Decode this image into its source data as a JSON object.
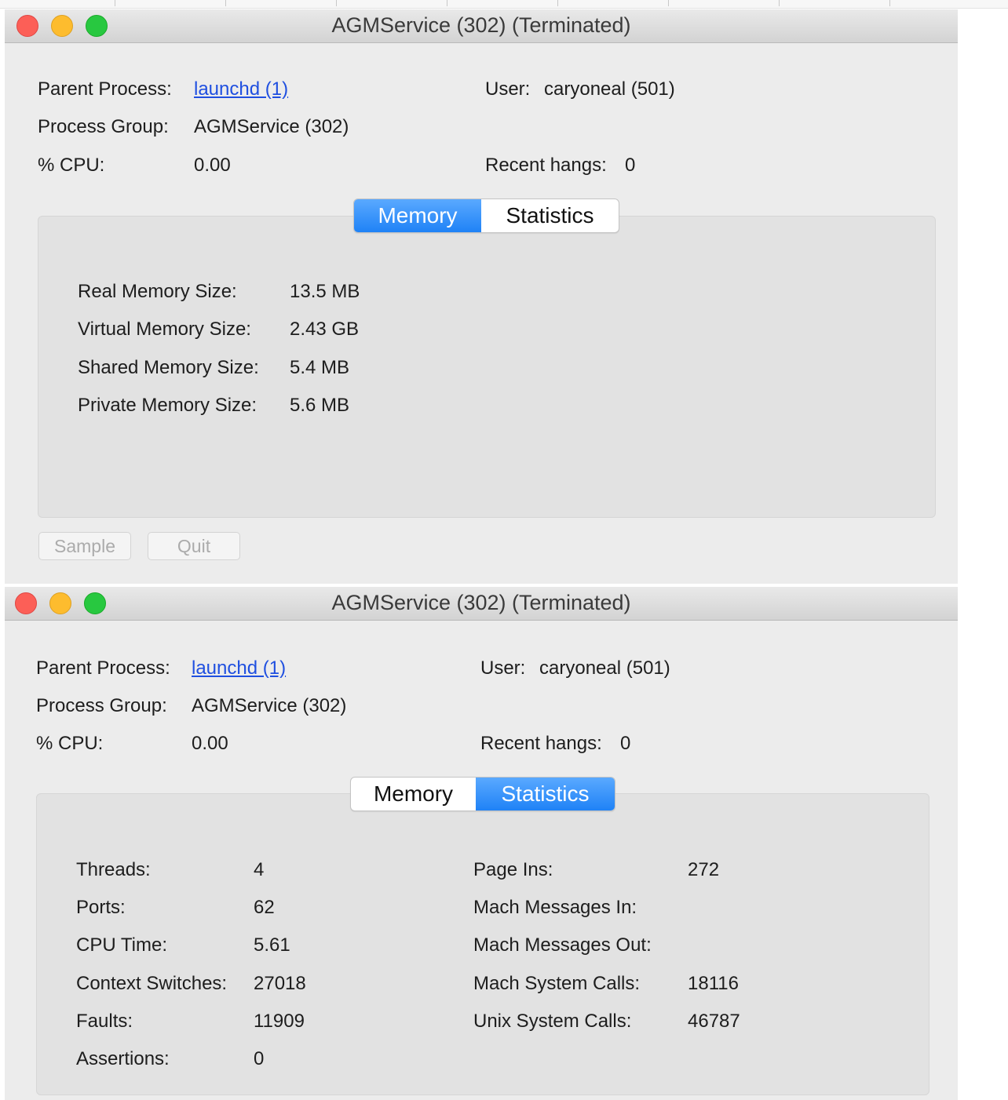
{
  "windows": [
    {
      "title": "AGMService (302) (Terminated)",
      "info": {
        "parent_label": "Parent Process:",
        "parent_value": "launchd (1)",
        "group_label": "Process Group:",
        "group_value": "AGMService (302)",
        "cpu_label": "% CPU:",
        "cpu_value": "0.00",
        "user_label": "User:",
        "user_value": "caryoneal (501)",
        "hangs_label": "Recent hangs:",
        "hangs_value": "0"
      },
      "tabs": [
        {
          "label": "Memory",
          "active": true
        },
        {
          "label": "Statistics",
          "active": false
        }
      ],
      "memory": [
        {
          "label": "Real Memory Size:",
          "value": "13.5 MB"
        },
        {
          "label": "Virtual Memory Size:",
          "value": "2.43 GB"
        },
        {
          "label": "Shared Memory Size:",
          "value": "5.4 MB"
        },
        {
          "label": "Private Memory Size:",
          "value": "5.6 MB"
        }
      ],
      "buttons": {
        "sample": "Sample",
        "quit": "Quit"
      }
    },
    {
      "title": "AGMService (302) (Terminated)",
      "info": {
        "parent_label": "Parent Process:",
        "parent_value": "launchd (1)",
        "group_label": "Process Group:",
        "group_value": "AGMService (302)",
        "cpu_label": "% CPU:",
        "cpu_value": "0.00",
        "user_label": "User:",
        "user_value": "caryoneal (501)",
        "hangs_label": "Recent hangs:",
        "hangs_value": "0"
      },
      "tabs": [
        {
          "label": "Memory",
          "active": false
        },
        {
          "label": "Statistics",
          "active": true
        }
      ],
      "stats_left": [
        {
          "label": "Threads:",
          "value": "4"
        },
        {
          "label": "Ports:",
          "value": "62"
        },
        {
          "label": "CPU Time:",
          "value": "5.61"
        },
        {
          "label": "Context Switches:",
          "value": "27018"
        },
        {
          "label": "Faults:",
          "value": "11909"
        },
        {
          "label": "Assertions:",
          "value": "0"
        }
      ],
      "stats_right": [
        {
          "label": "Page Ins:",
          "value": "272"
        },
        {
          "label": "Mach Messages In:",
          "value": ""
        },
        {
          "label": "Mach Messages Out:",
          "value": ""
        },
        {
          "label": "Mach System Calls:",
          "value": "18116"
        },
        {
          "label": "Unix System Calls:",
          "value": "46787"
        }
      ]
    }
  ],
  "colors": {
    "accent": "#1f82f6",
    "link": "#1f4fe0",
    "close": "#fc5f57",
    "minimize": "#fdbc2e",
    "zoom": "#28c840"
  }
}
